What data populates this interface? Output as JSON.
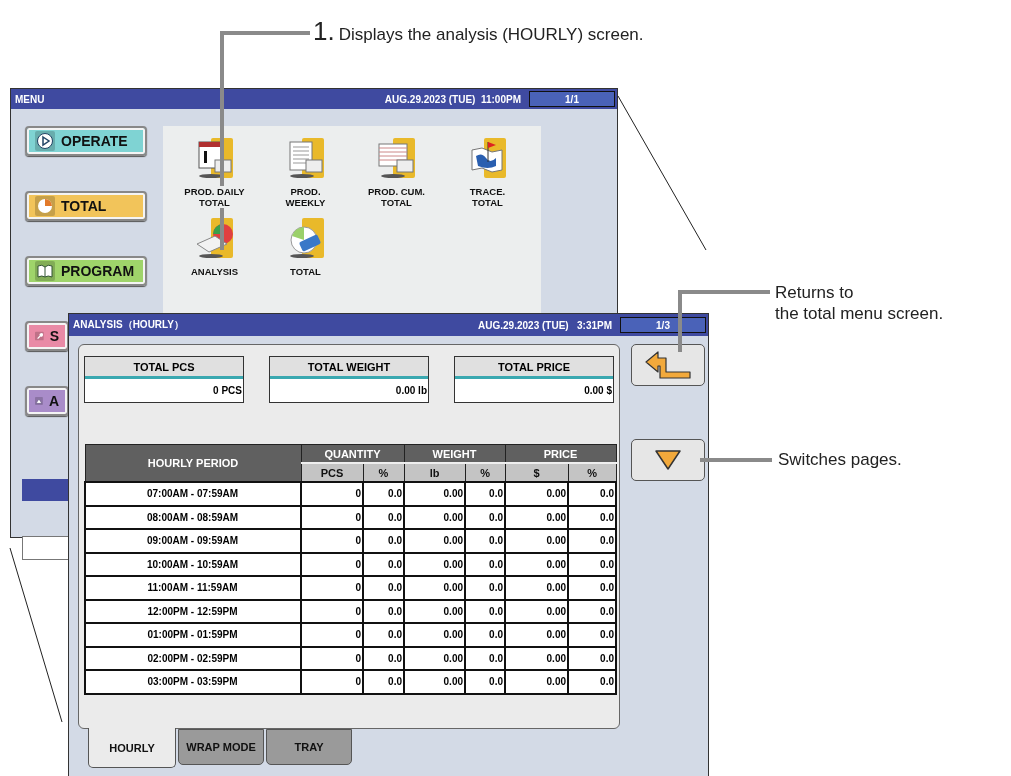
{
  "callouts": [
    {
      "number": "1.",
      "text": "Displays the analysis (HOURLY) screen."
    },
    {
      "text": "Returns to\nthe total menu screen."
    },
    {
      "text": "Switches pages."
    }
  ],
  "menu_screen": {
    "title": "MENU",
    "datetime": "AUG.29.2023 (TUE)  11:00PM",
    "page": "1/1",
    "side_buttons": [
      {
        "label": "OPERATE",
        "kind": "play",
        "color": "#7fd3d3"
      },
      {
        "label": "TOTAL",
        "kind": "pie",
        "color": "#f2c45a"
      },
      {
        "label": "PROGRAM",
        "kind": "book",
        "color": "#9fd46a"
      },
      {
        "label": "S",
        "kind": "wrench",
        "color": "#e98aa6"
      },
      {
        "label": "A",
        "kind": "mountain",
        "color": "#a98cc9"
      }
    ],
    "items": [
      {
        "label": "PROD. DAILY\nTOTAL",
        "kind": "daily"
      },
      {
        "label": "PROD.\nWEEKLY",
        "kind": "weekly"
      },
      {
        "label": "PROD. CUM.\nTOTAL",
        "kind": "cumulative"
      },
      {
        "label": "TRACE.\nTOTAL",
        "kind": "trace"
      },
      {
        "label": "ANALYSIS",
        "kind": "analysis"
      },
      {
        "label": "TOTAL",
        "kind": "clear"
      }
    ]
  },
  "analysis_screen": {
    "title": "ANALYSIS（HOURLY）",
    "datetime": "AUG.29.2023 (TUE)   3:31PM",
    "page": "1/3",
    "totals": [
      {
        "label": "TOTAL PCS",
        "value": "0 PCS"
      },
      {
        "label": "TOTAL WEIGHT",
        "value": "0.00 lb"
      },
      {
        "label": "TOTAL PRICE",
        "value": "0.00 $"
      }
    ],
    "table": {
      "period_header": "HOURLY PERIOD",
      "groups": [
        {
          "label": "QUANTITY",
          "columns": [
            "PCS",
            "%"
          ]
        },
        {
          "label": "WEIGHT",
          "columns": [
            "lb",
            "%"
          ]
        },
        {
          "label": "PRICE",
          "columns": [
            "$",
            "%"
          ]
        }
      ],
      "rows": [
        {
          "period": "07:00AM - 07:59AM",
          "cells": [
            "0",
            "0.0",
            "0.00",
            "0.0",
            "0.00",
            "0.0"
          ]
        },
        {
          "period": "08:00AM - 08:59AM",
          "cells": [
            "0",
            "0.0",
            "0.00",
            "0.0",
            "0.00",
            "0.0"
          ]
        },
        {
          "period": "09:00AM - 09:59AM",
          "cells": [
            "0",
            "0.0",
            "0.00",
            "0.0",
            "0.00",
            "0.0"
          ]
        },
        {
          "period": "10:00AM - 10:59AM",
          "cells": [
            "0",
            "0.0",
            "0.00",
            "0.0",
            "0.00",
            "0.0"
          ]
        },
        {
          "period": "11:00AM - 11:59AM",
          "cells": [
            "0",
            "0.0",
            "0.00",
            "0.0",
            "0.00",
            "0.0"
          ]
        },
        {
          "period": "12:00PM - 12:59PM",
          "cells": [
            "0",
            "0.0",
            "0.00",
            "0.0",
            "0.00",
            "0.0"
          ]
        },
        {
          "period": "01:00PM - 01:59PM",
          "cells": [
            "0",
            "0.0",
            "0.00",
            "0.0",
            "0.00",
            "0.0"
          ]
        },
        {
          "period": "02:00PM - 02:59PM",
          "cells": [
            "0",
            "0.0",
            "0.00",
            "0.0",
            "0.00",
            "0.0"
          ]
        },
        {
          "period": "03:00PM - 03:59PM",
          "cells": [
            "0",
            "0.0",
            "0.00",
            "0.0",
            "0.00",
            "0.0"
          ]
        }
      ]
    },
    "tabs": [
      {
        "label": "HOURLY",
        "selected": true
      },
      {
        "label": "WRAP MODE",
        "selected": false
      },
      {
        "label": "TRAY",
        "selected": false
      }
    ]
  }
}
